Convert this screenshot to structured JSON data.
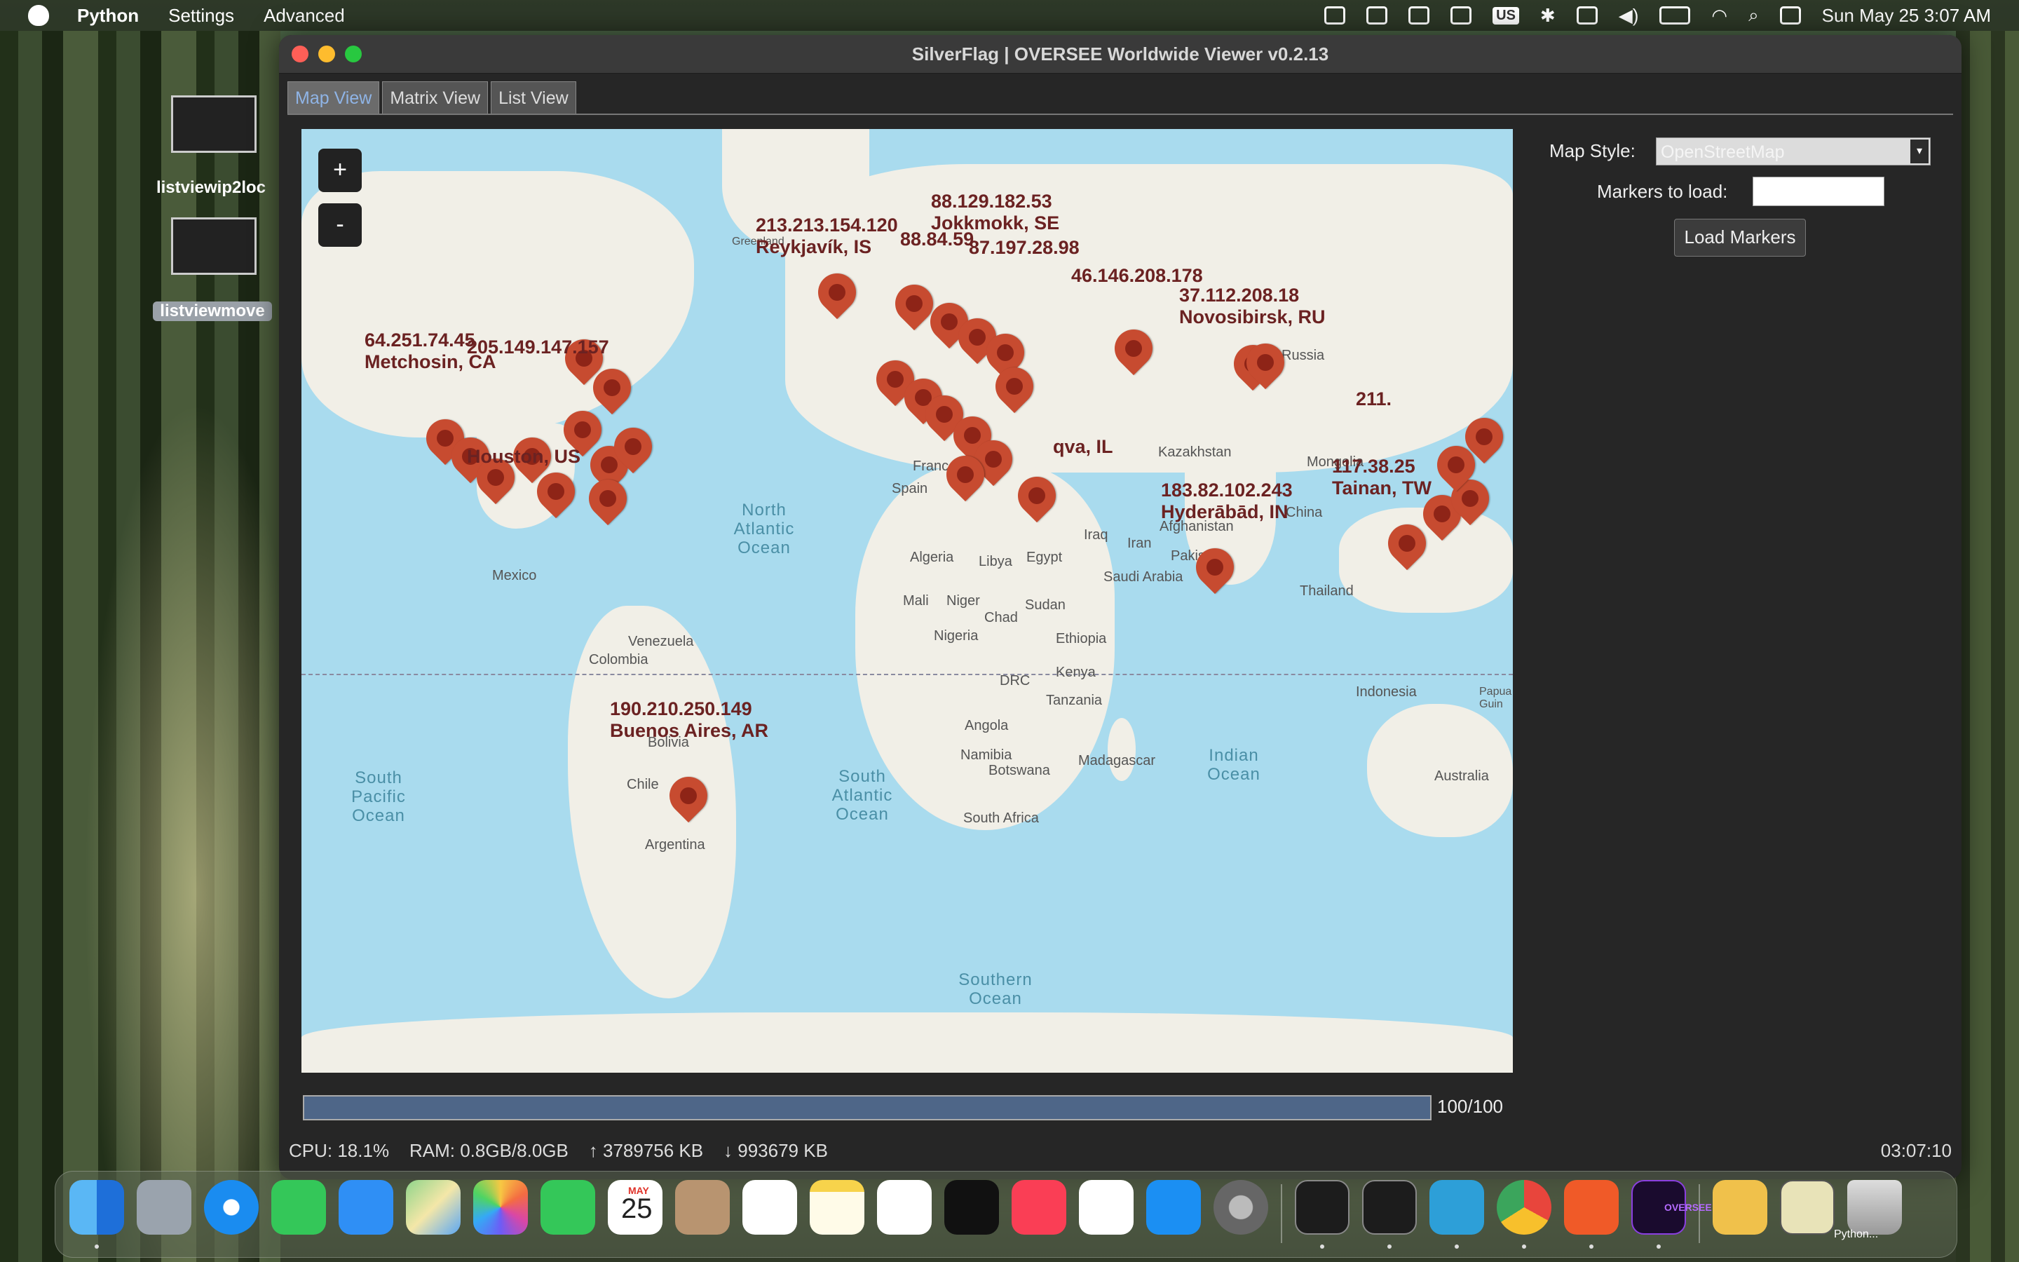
{
  "menubar": {
    "app": "Python",
    "items": [
      "Settings",
      "Advanced"
    ],
    "keyboard_layout": "US",
    "datetime": "Sun May 25  3:07 AM"
  },
  "desktop": {
    "icons": [
      {
        "label": "listviewip2loc"
      },
      {
        "label": "listviewmove"
      }
    ]
  },
  "window": {
    "title": "SilverFlag | OVERSEE Worldwide Viewer v0.2.13",
    "tabs": [
      {
        "label": "Map View",
        "active": true
      },
      {
        "label": "Matrix View",
        "active": false
      },
      {
        "label": "List View",
        "active": false
      }
    ],
    "map": {
      "zoom_in": "+",
      "zoom_out": "-",
      "ocean_labels": [
        "North\nAtlantic\nOcean",
        "South\nPacific\nOcean",
        "South\nAtlantic\nOcean",
        "Indian\nOcean",
        "Southern\nOcean"
      ],
      "country_labels": [
        "Greenland",
        "Mexico",
        "Venezuela",
        "Colombia",
        "Bolivia",
        "Chile",
        "Argentina",
        "Spain",
        "France",
        "Algeria",
        "Libya",
        "Egypt",
        "Mali",
        "Niger",
        "Chad",
        "Sudan",
        "Nigeria",
        "Ethiopia",
        "DRC",
        "Kenya",
        "Tanzania",
        "Angola",
        "Namibia",
        "Botswana",
        "South Africa",
        "Madagascar",
        "Saudi Arabia",
        "Iraq",
        "Iran",
        "Afghanistan",
        "Pakistan",
        "Kazakhstan",
        "Mongolia",
        "China",
        "Thailand",
        "Indonesia",
        "Papua\nGuin",
        "Australia",
        "Russia"
      ],
      "marker_labels": [
        {
          "ip": "213.213.154.120",
          "city": "Reykjavík, IS"
        },
        {
          "ip": "88.129.182.53",
          "city": "Jokkmokk, SE"
        },
        {
          "ip": "88.84.59",
          "city": ""
        },
        {
          "ip": "87.197.28.98",
          "city": ""
        },
        {
          "ip": "46.146.208.178",
          "city": ""
        },
        {
          "ip": "37.112.208.18",
          "city": "Novosibirsk, RU"
        },
        {
          "ip": "64.251.74.45",
          "city": "Metchosin, CA"
        },
        {
          "ip": "205.149.147.157",
          "city": ""
        },
        {
          "ip": "",
          "city": "Houston, US"
        },
        {
          "ip": "",
          "city": "qva, IL"
        },
        {
          "ip": "183.82.102.243",
          "city": "Hyderābād, IN"
        },
        {
          "ip": "211.",
          "city": ""
        },
        {
          "ip": "117.38.25",
          "city": "Tainan, TW"
        },
        {
          "ip": "190.210.250.149",
          "city": "Buenos Aires, AR"
        }
      ],
      "marker_count": 34
    },
    "side": {
      "map_style_label": "Map Style:",
      "map_style_value": "OpenStreetMap",
      "markers_label": "Markers to load:",
      "markers_value": "",
      "load_button": "Load Markers"
    },
    "progress": {
      "value": 100,
      "max": 100,
      "text": "100/100"
    },
    "status": {
      "cpu": "CPU: 18.1%",
      "ram": "RAM: 0.8GB/8.0GB",
      "up": "↑ 3789756 KB",
      "down": "↓ 993679 KB",
      "clock": "03:07:10"
    }
  },
  "dock": {
    "calendar_month": "MAY",
    "calendar_day": "25",
    "apps": [
      "Finder",
      "Launchpad",
      "Safari",
      "Messages",
      "Mail",
      "Maps",
      "Photos",
      "FaceTime",
      "Calendar",
      "Contacts",
      "Reminders",
      "Notes",
      "Freeform",
      "TV",
      "Music",
      "News",
      "App Store",
      "System Settings",
      "Activity Monitor",
      "Terminal",
      "VSCodium",
      "Chrome",
      "Brave",
      "OVERSEE",
      "Downloads",
      "Python",
      "Trash"
    ],
    "python_caption": "Python...",
    "oversee_caption": "OVERSEE",
    "colors": {
      "marker": "#c74b30",
      "ocean": "#a9dbee",
      "land": "#f1efe7"
    }
  }
}
